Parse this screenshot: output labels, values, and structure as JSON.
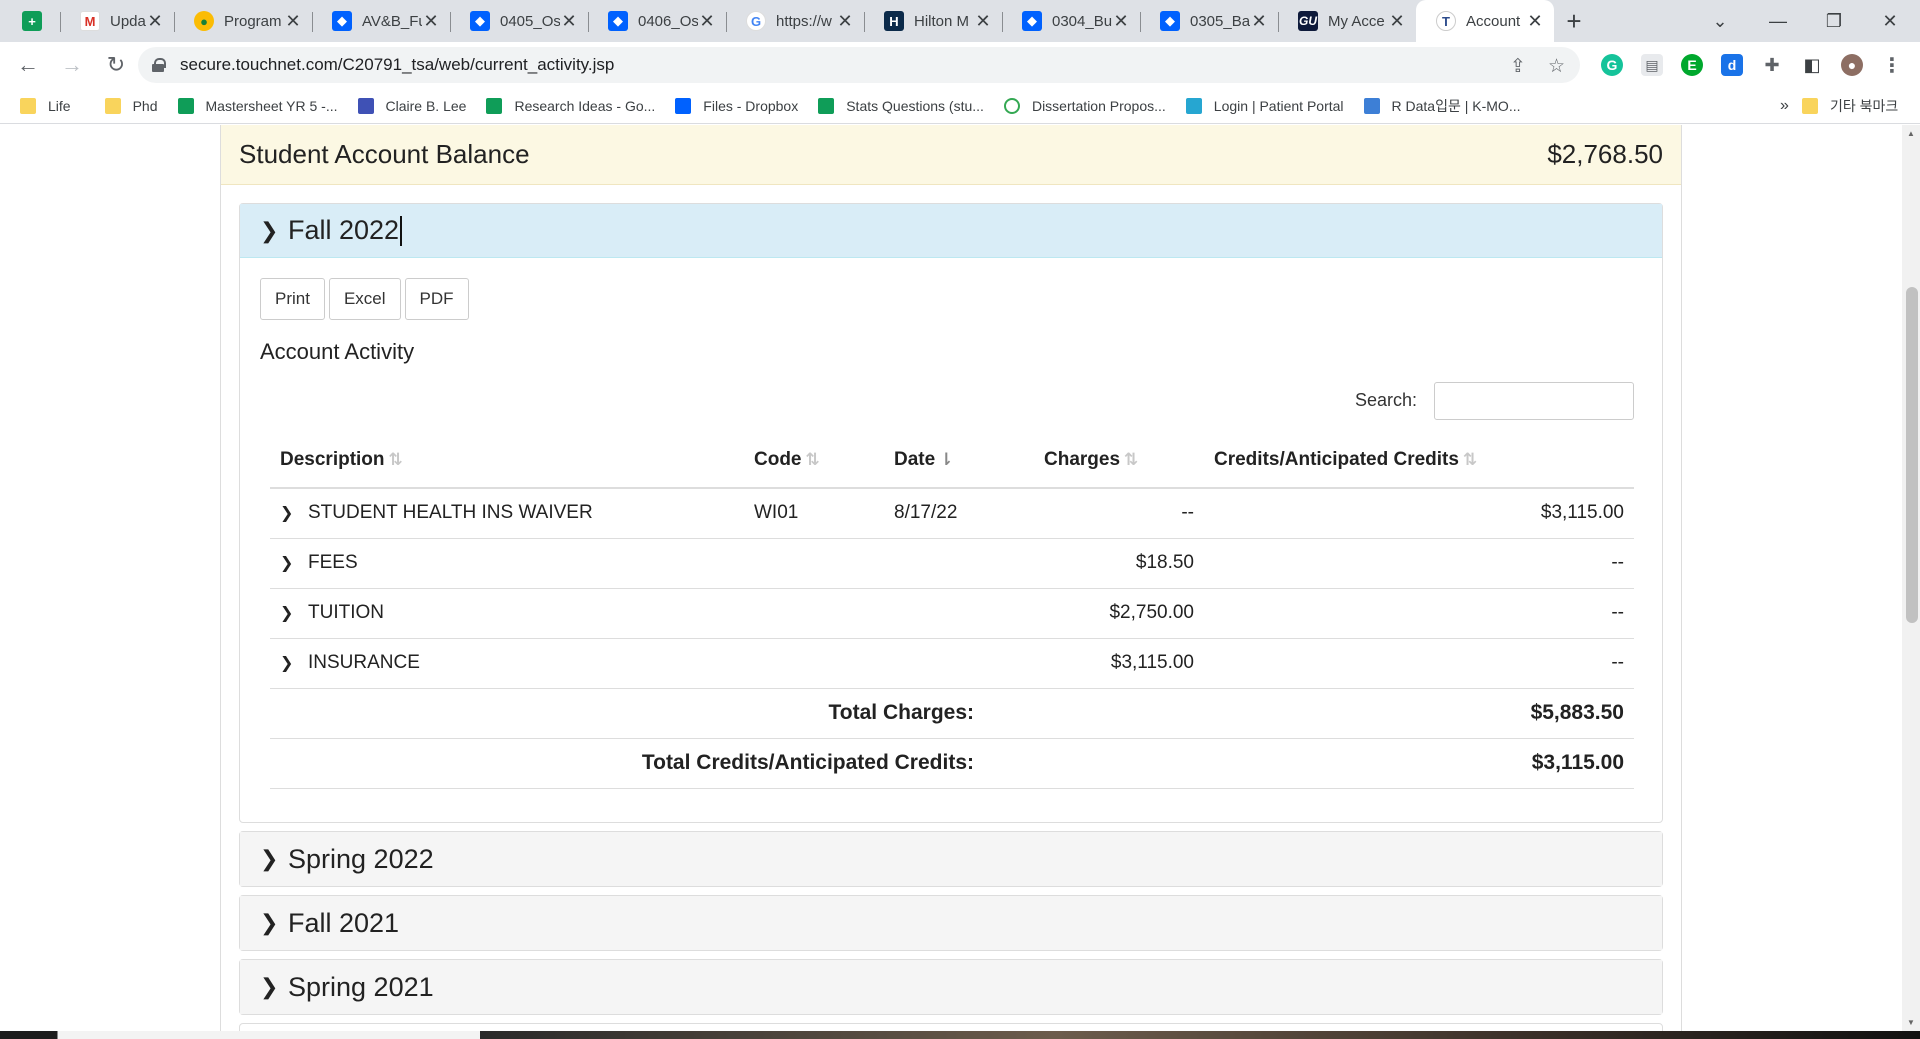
{
  "browser": {
    "tabs": [
      {
        "title": "",
        "icon": "sheets-icon",
        "glyph": "+"
      },
      {
        "title": "Updated",
        "icon": "gmail-icon",
        "glyph": "M"
      },
      {
        "title": "Program",
        "icon": "chrome-store-icon",
        "glyph": "●"
      },
      {
        "title": "AV&B_Fu",
        "icon": "dropbox-icon",
        "glyph": "◆"
      },
      {
        "title": "0405_Os",
        "icon": "dropbox-icon",
        "glyph": "◆"
      },
      {
        "title": "0406_Os",
        "icon": "dropbox-icon",
        "glyph": "◆"
      },
      {
        "title": "https://w",
        "icon": "google-icon",
        "glyph": "G"
      },
      {
        "title": "Hilton M",
        "icon": "hilton-icon",
        "glyph": "H"
      },
      {
        "title": "0304_Bu",
        "icon": "dropbox-icon",
        "glyph": "◆"
      },
      {
        "title": "0305_Ba",
        "icon": "dropbox-icon",
        "glyph": "◆"
      },
      {
        "title": "My Acce",
        "icon": "gu-icon",
        "glyph": "GU"
      },
      {
        "title": "Account",
        "icon": "touchnet-icon",
        "glyph": "T"
      }
    ],
    "url": "secure.touchnet.com/C20791_tsa/web/current_activity.jsp",
    "bookmarks": [
      {
        "label": "Life",
        "icon": "folder-icon"
      },
      {
        "label": "Phd",
        "icon": "folder-icon"
      },
      {
        "label": "Mastersheet YR 5 -...",
        "icon": "sheets-icon"
      },
      {
        "label": "Claire B. Lee",
        "icon": "calendar-icon"
      },
      {
        "label": "Research Ideas - Go...",
        "icon": "sheets-icon"
      },
      {
        "label": "Files - Dropbox",
        "icon": "dropbox-icon"
      },
      {
        "label": "Stats Questions (stu...",
        "icon": "sheets-icon"
      },
      {
        "label": "Dissertation Propos...",
        "icon": "leaf-icon"
      },
      {
        "label": "Login | Patient Portal",
        "icon": "portal-icon"
      },
      {
        "label": "R Data입문 | K-MO...",
        "icon": "kmooc-icon"
      }
    ],
    "more_bookmarks": "»",
    "other_bookmarks": "기타 북마크"
  },
  "page": {
    "balance_label": "Student Account Balance",
    "balance_value": "$2,768.50",
    "open_term": "Fall 2022",
    "buttons": {
      "print": "Print",
      "excel": "Excel",
      "pdf": "PDF"
    },
    "section_title": "Account Activity",
    "search_label": "Search:",
    "search_value": "",
    "columns": [
      "Description",
      "Code",
      "Date",
      "Charges",
      "Credits/Anticipated Credits"
    ],
    "rows": [
      {
        "description": "STUDENT HEALTH INS WAIVER",
        "code": "WI01",
        "date": "8/17/22",
        "charges": "--",
        "credits": "$3,115.00"
      },
      {
        "description": "FEES",
        "code": "",
        "date": "",
        "charges": "$18.50",
        "credits": "--"
      },
      {
        "description": "TUITION",
        "code": "",
        "date": "",
        "charges": "$2,750.00",
        "credits": "--"
      },
      {
        "description": "INSURANCE",
        "code": "",
        "date": "",
        "charges": "$3,115.00",
        "credits": "--"
      }
    ],
    "totals": [
      {
        "label": "Total Charges:",
        "value": "$5,883.50"
      },
      {
        "label": "Total Credits/Anticipated Credits:",
        "value": "$3,115.00"
      }
    ],
    "collapsed_terms": [
      "Spring 2022",
      "Fall 2021",
      "Spring 2021"
    ]
  }
}
